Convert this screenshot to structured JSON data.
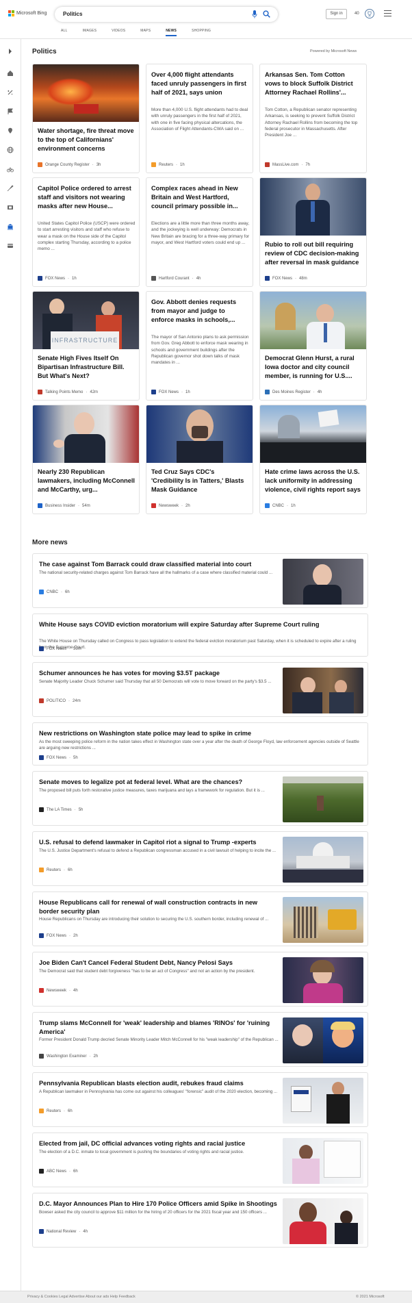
{
  "header": {
    "brand": "Microsoft Bing",
    "query": "Politics",
    "signin": "Sign in",
    "points": "40",
    "tabs": [
      "ALL",
      "IMAGES",
      "VIDEOS",
      "MAPS",
      "NEWS",
      "SHOPPING"
    ],
    "active_tab": "NEWS"
  },
  "sidebar": {
    "icons": [
      "expand-icon",
      "home-icon",
      "tools-icon",
      "flag-icon",
      "location-icon",
      "globe-icon",
      "bicycle-icon",
      "rocket-icon",
      "film-icon",
      "bank-icon",
      "card-icon"
    ]
  },
  "politics": {
    "title": "Politics",
    "powered": "Powered by Microsoft News",
    "cards": [
      {
        "title": "Water shortage, fire threat move to the top of Californians' environment concerns",
        "desc": "",
        "source": "Orange County Register",
        "time": "3h",
        "logo_color": "#e8742a",
        "has_image": true
      },
      {
        "title": "Over 4,000 flight attendants faced unruly passengers in first half of 2021, says union",
        "desc": "More than 4,000 U.S. flight attendants had to deal with unruly passengers in the first half of 2021, with one in five facing physical altercations, the Association of Flight Attendants-CWA said on ...",
        "source": "Reuters",
        "time": "1h",
        "logo_color": "#f39c2a",
        "has_image": false
      },
      {
        "title": "Arkansas Sen. Tom Cotton vows to block Suffolk District Attorney Rachael Rollins'...",
        "desc": "Tom Cotton, a Republican senator representing Arkansas, is seeking to prevent Suffolk District Attorney Rachael Rollins from becoming the top federal prosecutor in Massachusetts. After President Joe ...",
        "source": "MassLive.com",
        "time": "7h",
        "logo_color": "#c0392b",
        "has_image": false
      },
      {
        "title": "Capitol Police ordered to arrest staff and visitors not wearing masks after new House...",
        "desc": "United States Capitol Police (USCP) were ordered to start arresting visitors and staff who refuse to wear a mask on the House side of the Capitol complex starting Thursday, according to a police memo ...",
        "source": "FOX News",
        "time": "1h",
        "logo_color": "#1d3f8c",
        "has_image": false
      },
      {
        "title": "Complex races ahead in New Britain and West Hartford, council primary possible in...",
        "desc": "Elections are a little more than three months away, and the jockeying is well underway: Democrats in New Britain are bracing for a three-way primary for mayor, and West Hartford voters could end up ...",
        "source": "Hartford Courant",
        "time": "4h",
        "logo_color": "#555555",
        "has_image": false
      },
      {
        "title": "Rubio to roll out bill requiring review of CDC decision-making after reversal in mask guidance",
        "desc": "",
        "source": "FOX News",
        "time": "48m",
        "logo_color": "#1d3f8c",
        "has_image": true
      },
      {
        "title": "Senate High Fives Itself On Bipartisan Infrastructure Bill. But What's Next?",
        "desc": "",
        "source": "Talking Points Memo",
        "time": "42m",
        "logo_color": "#c0392b",
        "has_image": true
      },
      {
        "title": "Gov. Abbott denies requests from mayor and judge to enforce masks in schools,...",
        "desc": "The mayor of San Antonio plans to ask permission from Gov. Greg Abbott to enforce mask wearing in schools and government buildings after the Republican governor shot down talks of mask mandates in ...",
        "source": "FOX News",
        "time": "1h",
        "logo_color": "#1d3f8c",
        "has_image": false
      },
      {
        "title": "Democrat Glenn Hurst, a rural Iowa doctor and city council member, is running for U.S....",
        "desc": "",
        "source": "Des Moines Register",
        "time": "4h",
        "logo_color": "#2c6fb7",
        "has_image": true
      },
      {
        "title": "Nearly 230 Republican lawmakers, including McConnell and McCarthy, urg...",
        "desc": "",
        "source": "Business Insider",
        "time": "54m",
        "logo_color": "#1e63c8",
        "has_image": true
      },
      {
        "title": "Ted Cruz Says CDC's 'Credibility Is in Tatters,' Blasts Mask Guidance",
        "desc": "",
        "source": "Newsweek",
        "time": "2h",
        "logo_color": "#d0312d",
        "has_image": true
      },
      {
        "title": "Hate crime laws across the U.S. lack uniformity in addressing violence, civil rights report says",
        "desc": "",
        "source": "CNBC",
        "time": "1h",
        "logo_color": "#2a7de1",
        "has_image": true
      }
    ]
  },
  "more_news": {
    "title": "More news",
    "items": [
      {
        "title": "The case against Tom Barrack could draw classified material into court",
        "desc": "The national security-related charges against Tom Barrack have all the hallmarks of a case where classified material could ...",
        "source": "CNBC",
        "time": "6h",
        "logo_color": "#2a7de1",
        "has_image": true
      },
      {
        "title": "White House says COVID eviction moratorium will expire Saturday after Supreme Court ruling",
        "desc": "The White House on Thursday called on Congress to pass legislation to extend the federal eviction moratorium past Saturday, when it is scheduled to expire after a ruling from the Supreme Court.",
        "source": "FOX News",
        "time": "55m",
        "logo_color": "#1d3f8c",
        "has_image": false
      },
      {
        "title": "Schumer announces he has votes for moving $3.5T package",
        "desc": "Senate Majority Leader Chuck Schumer said Thursday that all 50 Democrats will vote to move forward on the party's $3.5 ...",
        "source": "POLITICO",
        "time": "24m",
        "logo_color": "#c0392b",
        "has_image": true
      },
      {
        "title": "New restrictions on Washington state police may lead to spike in crime",
        "desc": "As the most sweeping police reform in the nation takes effect in Washington state over a year after the death of George Floyd, law enforcement agencies outside of Seattle are arguing new restrictions ...",
        "source": "FOX News",
        "time": "5h",
        "logo_color": "#1d3f8c",
        "has_image": false
      },
      {
        "title": "Senate moves to legalize pot at federal level. What are the chances?",
        "desc": "The proposed bill puts forth restorative justice measures, taxes marijuana and lays a framework for regulation. But it is ...",
        "source": "The LA Times",
        "time": "5h",
        "logo_color": "#222222",
        "has_image": true
      },
      {
        "title": "U.S. refusal to defend lawmaker in Capitol riot a signal to Trump -experts",
        "desc": "The U.S. Justice Department's refusal to defend a Republican congressman accused in a civil lawsuit of helping to incite the ...",
        "source": "Reuters",
        "time": "6h",
        "logo_color": "#f39c2a",
        "has_image": true
      },
      {
        "title": "House Republicans call for renewal of wall construction contracts in new border security plan",
        "desc": "House Republicans on Thursday are introducing their solution to securing the U.S. southern border, including renewal of ...",
        "source": "FOX News",
        "time": "2h",
        "logo_color": "#1d3f8c",
        "has_image": true
      },
      {
        "title": "Joe Biden Can't Cancel Federal Student Debt, Nancy Pelosi Says",
        "desc": "The Democrat said that student debt forgiveness \"has to be an act of Congress\" and not an action by the president.",
        "source": "Newsweek",
        "time": "4h",
        "logo_color": "#d0312d",
        "has_image": true
      },
      {
        "title": "Trump slams McConnell for 'weak' leadership and blames 'RINOs' for 'ruining America'",
        "desc": "Former President Donald Trump decried Senate Minority Leader Mitch McConnell for his \"weak leadership\" of the Republican ...",
        "source": "Washington Examiner",
        "time": "2h",
        "logo_color": "#444444",
        "has_image": true
      },
      {
        "title": "Pennsylvania Republican blasts election audit, rebukes fraud claims",
        "desc": "A Republican lawmaker in Pennsylvania has come out against his colleagues' \"forensic\" audit of the 2020 election, becoming ...",
        "source": "Reuters",
        "time": "6h",
        "logo_color": "#f39c2a",
        "has_image": true
      },
      {
        "title": "Elected from jail, DC official advances voting rights and racial justice",
        "desc": "The election of a D.C. inmate to local government is pushing the boundaries of voting rights and racial justice.",
        "source": "ABC News",
        "time": "6h",
        "logo_color": "#222222",
        "has_image": true
      },
      {
        "title": "D.C. Mayor Announces Plan to Hire 170 Police Officers amid Spike in Shootings",
        "desc": "Bowser asked the city council to approve $11 million for the hiring of 20 officers for the 2021 fiscal year and 150 officers ...",
        "source": "National Review",
        "time": "4h",
        "logo_color": "#1d3f8c",
        "has_image": true
      }
    ]
  },
  "footer": {
    "left": "Privacy & Cookies   Legal   Advertise   About our ads   Help   Feedback",
    "right": "© 2021 Microsoft"
  }
}
